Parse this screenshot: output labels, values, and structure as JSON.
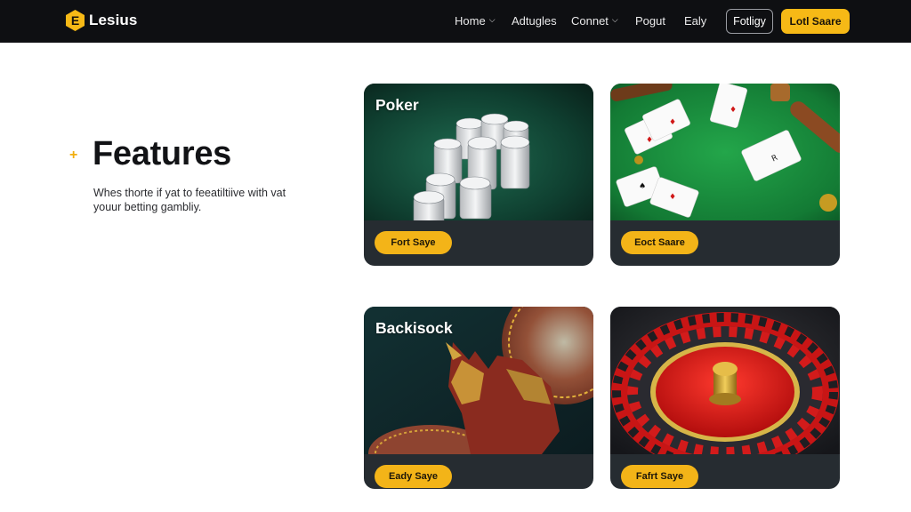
{
  "brand": {
    "name": "Lesius",
    "mark_letter": "E",
    "accent_color": "#f6b916"
  },
  "nav": {
    "items": [
      {
        "label": "Home",
        "has_dropdown": true
      },
      {
        "label": "Adtugles",
        "has_dropdown": false
      },
      {
        "label": "Connet",
        "has_dropdown": true
      },
      {
        "label": "Pogut",
        "has_dropdown": false
      },
      {
        "label": "Ealy",
        "has_dropdown": false
      }
    ],
    "outline_button": "Fotligy",
    "cta_button": "Lotl Saare"
  },
  "hero": {
    "title": "Features",
    "subtitle": "Whes thorte if yat to feeatiltiive with vat youur betting gambliy."
  },
  "cards": [
    {
      "title": "Poker",
      "button": "Fort Saye",
      "image": "poker-chips"
    },
    {
      "title": "",
      "button": "Eoct Saare",
      "image": "cards-table"
    },
    {
      "title": "Backisock",
      "button": "Eady Saye",
      "image": "warrior-wheel"
    },
    {
      "title": "",
      "button": "Fafrt Saye",
      "image": "roulette-wheel"
    }
  ],
  "icons": {
    "plus": "plus-icon",
    "chevron": "chevron-down-icon"
  }
}
